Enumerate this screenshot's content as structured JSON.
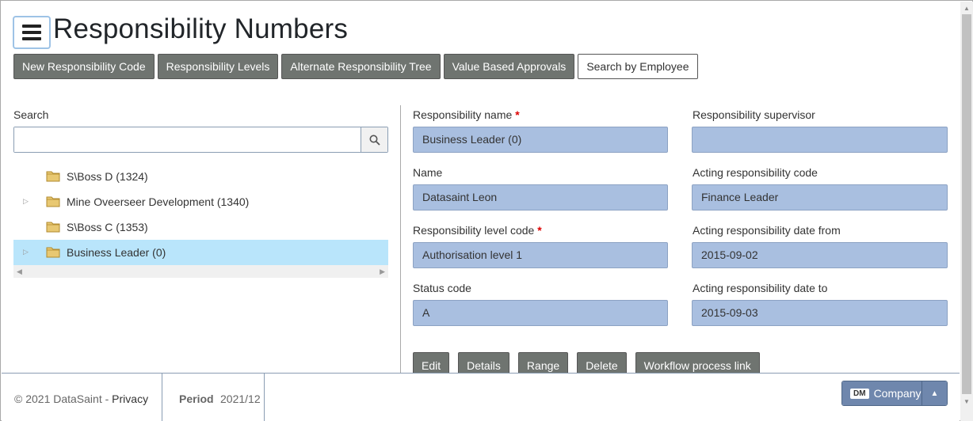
{
  "header": {
    "title": "Responsibility Numbers"
  },
  "tabs": [
    {
      "label": "New Responsibility Code"
    },
    {
      "label": "Responsibility Levels"
    },
    {
      "label": "Alternate Responsibility Tree"
    },
    {
      "label": "Value Based Approvals"
    },
    {
      "label": "Search by Employee"
    }
  ],
  "search": {
    "label": "Search",
    "value": "",
    "placeholder": ""
  },
  "tree": {
    "items": [
      {
        "label": "S\\Boss D (1324)",
        "expandable": false,
        "selected": false
      },
      {
        "label": "Mine Oveerseer Development (1340)",
        "expandable": true,
        "selected": false
      },
      {
        "label": "S\\Boss C (1353)",
        "expandable": false,
        "selected": false
      },
      {
        "label": "Business Leader (0)",
        "expandable": true,
        "selected": true
      }
    ]
  },
  "form": {
    "responsibility_name": {
      "label": "Responsibility name",
      "value": "Business Leader (0)",
      "required": true
    },
    "responsibility_supervisor": {
      "label": "Responsibility supervisor",
      "value": ""
    },
    "name": {
      "label": "Name",
      "value": "Datasaint Leon"
    },
    "acting_responsibility_code": {
      "label": "Acting responsibility code",
      "value": "Finance Leader"
    },
    "responsibility_level_code": {
      "label": "Responsibility level code",
      "value": "Authorisation level 1",
      "required": true
    },
    "acting_date_from": {
      "label": "Acting responsibility date from",
      "value": "2015-09-02"
    },
    "status_code": {
      "label": "Status code",
      "value": "A"
    },
    "acting_date_to": {
      "label": "Acting responsibility date to",
      "value": "2015-09-03"
    },
    "required_mark": "*"
  },
  "actions": {
    "edit": "Edit",
    "details": "Details",
    "range": "Range",
    "delete": "Delete",
    "workflow": "Workflow process link"
  },
  "footer": {
    "copyright": "© 2021 DataSaint - ",
    "privacy": "Privacy",
    "period_label": "Period",
    "period_value": "2021/12",
    "company_badge": "DM",
    "company_label": "Company"
  },
  "colors": {
    "button_bg": "#6f7470",
    "field_bg": "#a9bfe0",
    "selected_row": "#b9e5fb",
    "company_bg": "#6f87ad"
  }
}
